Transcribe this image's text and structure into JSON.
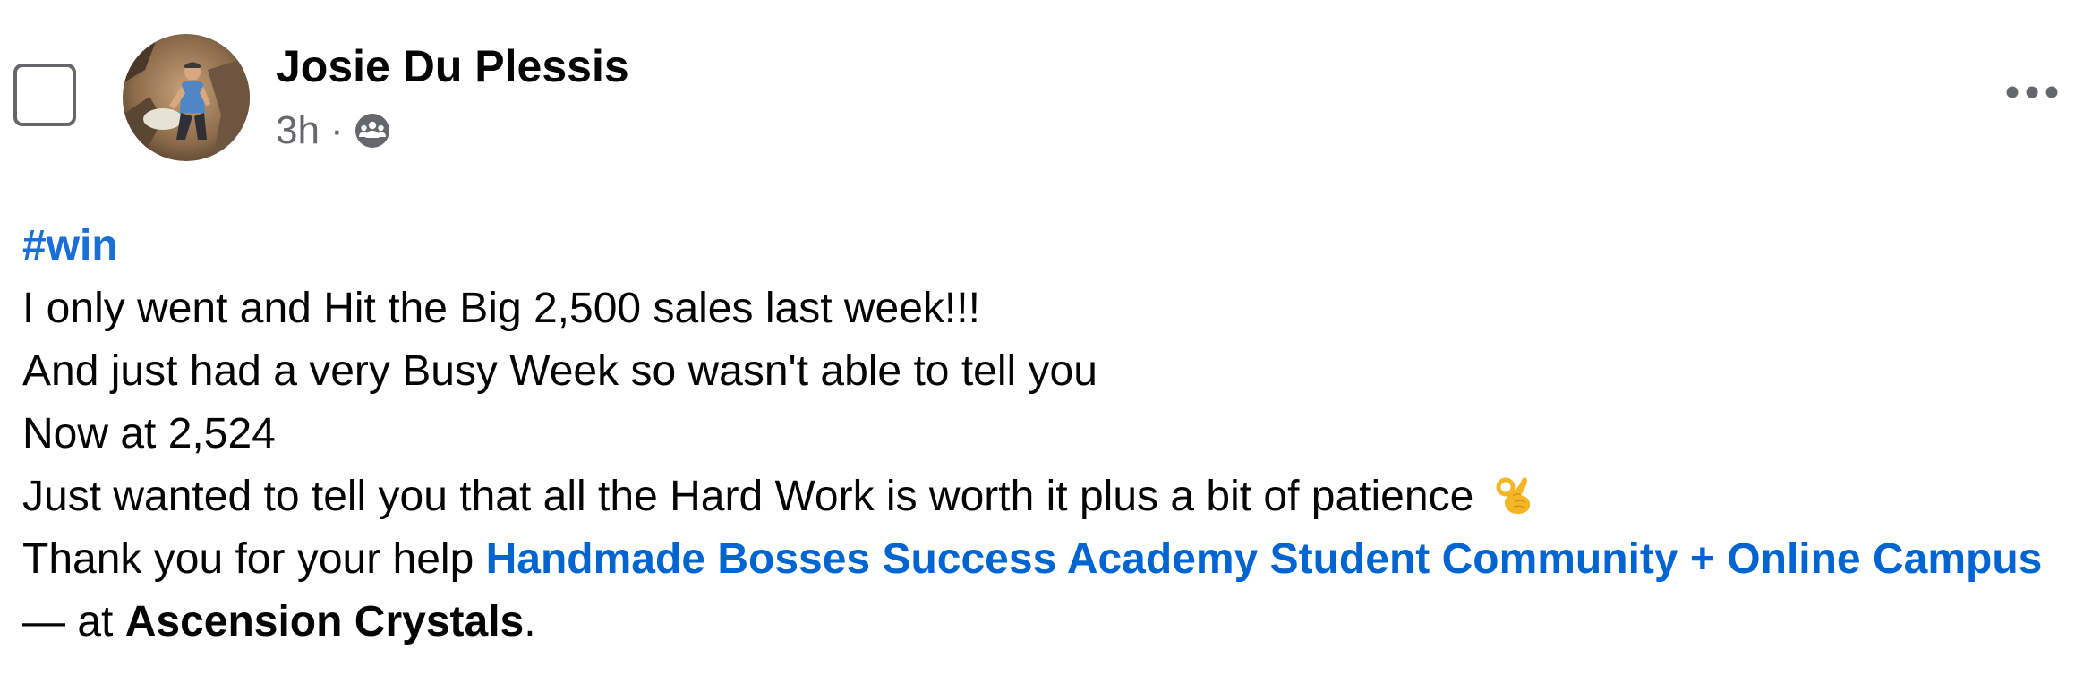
{
  "post": {
    "author_name": "Josie Du Plessis",
    "timestamp": "3h",
    "separator": "·",
    "audience_icon": "group-icon",
    "more_icon": "more-options-icon",
    "select_icon": "select-checkbox",
    "body": {
      "hashtag": "#win",
      "line1": "I only went and Hit the Big 2,500 sales last week!!!",
      "line2": "And just had a very Busy Week so wasn't able to tell you",
      "line3": "Now at 2,524",
      "line4": "Just wanted to tell you that all the Hard Work is worth it plus a bit of patience",
      "line4_emoji": "ok-hand-emoji",
      "line5_prefix": "Thank you for your help ",
      "group_link": "Handmade Bosses Success Academy Student Community + Online Campus",
      "at_text": "— at ",
      "location": "Ascension Crystals",
      "end_punct": "."
    }
  },
  "colors": {
    "link": "#0064d1",
    "secondary_text": "#65676b",
    "primary_text": "#050505"
  }
}
